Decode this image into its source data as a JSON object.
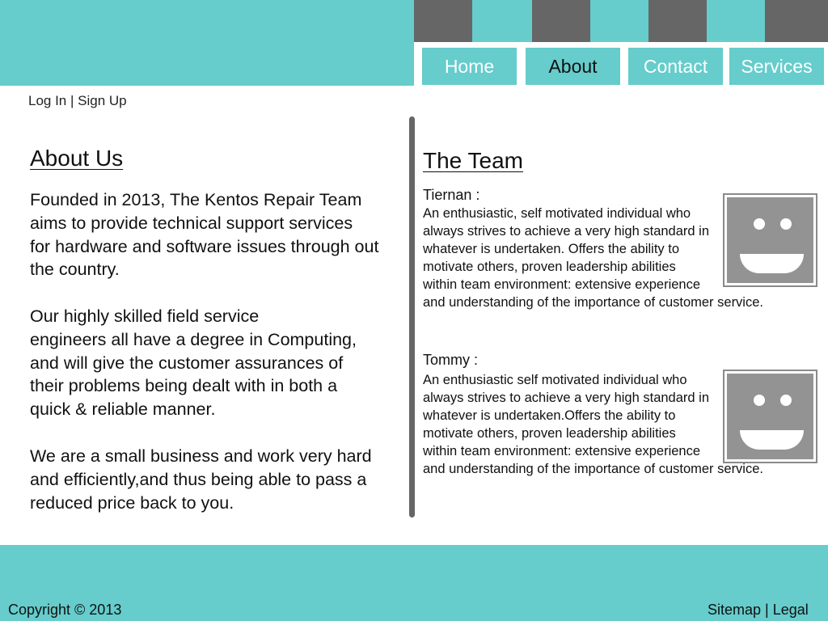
{
  "colors": {
    "brand": "#66cccc",
    "dark": "#666666",
    "avatar": "#939393"
  },
  "nav": {
    "items": [
      {
        "label": "Home",
        "active": false
      },
      {
        "label": "About",
        "active": true
      },
      {
        "label": "Contact",
        "active": false
      },
      {
        "label": "Services",
        "active": false
      }
    ]
  },
  "auth": {
    "login": "Log In",
    "separator": " | ",
    "signup": "Sign Up"
  },
  "about": {
    "title": "About Us",
    "paragraphs": [
      "Founded in 2013, The Kentos Repair Team\naims to provide technical support services\nfor hardware and software issues through out\nthe country.",
      "Our highly skilled field service\nengineers all have a degree in Computing,\nand will give the customer assurances of\ntheir problems being dealt with in both a\nquick & reliable manner.",
      "We are a small business and work very hard\nand efficiently,and thus being able to pass a\nreduced price back to you."
    ]
  },
  "team": {
    "title": "The Team",
    "members": [
      {
        "name": "Tiernan :",
        "bio": "An enthusiastic, self motivated individual who\nalways strives to achieve a very high standard in\nwhatever is undertaken. Offers the ability to\nmotivate others, proven leadership abilities\nwithin team environment: extensive experience\nand understanding of the importance of customer service.",
        "avatar_icon": "smiley-face-icon"
      },
      {
        "name": "Tommy :",
        "bio": "An enthusiastic self motivated individual who\nalways strives to achieve a very high standard in\nwhatever is undertaken.Offers the ability to\nmotivate others, proven leadership abilities\nwithin team environment: extensive experience\nand understanding of the importance of customer service.",
        "avatar_icon": "smiley-face-icon"
      }
    ]
  },
  "footer": {
    "copyright": "Copyright © 2013",
    "sitemap": "Sitemap",
    "separator": " | ",
    "legal": "Legal"
  }
}
